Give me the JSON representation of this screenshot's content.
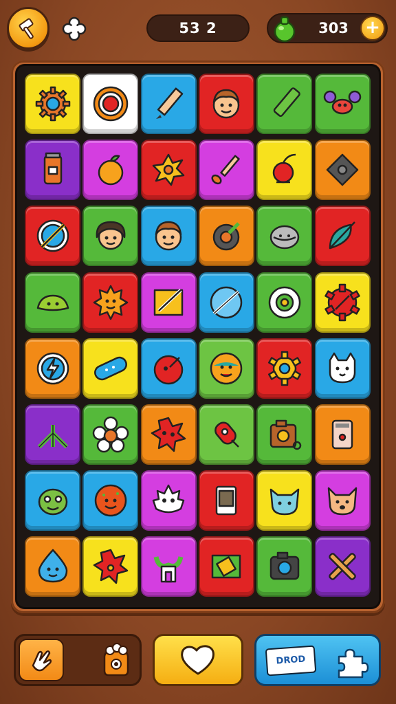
{
  "top_bar": {
    "moves_value": "53 2",
    "coins_value": "303",
    "plus_label": "+"
  },
  "board": {
    "rows": 8,
    "cols": 6,
    "tiles": [
      [
        {
          "color": "#f7e11d",
          "icon": "gear-icon"
        },
        {
          "color": "#ffffff",
          "icon": "target-icon"
        },
        {
          "color": "#29a8e6",
          "icon": "pencil-icon"
        },
        {
          "color": "#e12424",
          "icon": "boy-face-icon"
        },
        {
          "color": "#55b93a",
          "icon": "marker-icon"
        },
        {
          "color": "#55b93a",
          "icon": "crab-icon"
        }
      ],
      [
        {
          "color": "#8a2fc9",
          "icon": "jar-icon"
        },
        {
          "color": "#d43ee0",
          "icon": "orange-icon"
        },
        {
          "color": "#e12424",
          "icon": "splat-icon"
        },
        {
          "color": "#d43ee0",
          "icon": "brush-icon"
        },
        {
          "color": "#f7e11d",
          "icon": "cherry-icon"
        },
        {
          "color": "#f28a16",
          "icon": "diamond-icon"
        }
      ],
      [
        {
          "color": "#e12424",
          "icon": "compass-icon"
        },
        {
          "color": "#55b93a",
          "icon": "girl-face-icon"
        },
        {
          "color": "#29a8e6",
          "icon": "boy-face-icon"
        },
        {
          "color": "#f28a16",
          "icon": "donut-icon"
        },
        {
          "color": "#55b93a",
          "icon": "helmet-icon"
        },
        {
          "color": "#e12424",
          "icon": "leaf-icon"
        }
      ],
      [
        {
          "color": "#55b93a",
          "icon": "blob-icon"
        },
        {
          "color": "#e12424",
          "icon": "sun-face-icon"
        },
        {
          "color": "#d43ee0",
          "icon": "note-icon"
        },
        {
          "color": "#29a8e6",
          "icon": "planet-icon"
        },
        {
          "color": "#55b93a",
          "icon": "cog-ring-icon"
        },
        {
          "color": "#f7e11d",
          "icon": "red-cog-icon"
        }
      ],
      [
        {
          "color": "#f28a16",
          "icon": "bolt-icon"
        },
        {
          "color": "#f7e11d",
          "icon": "bandage-icon"
        },
        {
          "color": "#29a8e6",
          "icon": "red-ball-icon"
        },
        {
          "color": "#6dc443",
          "icon": "smiley-icon"
        },
        {
          "color": "#e12424",
          "icon": "gear-yellow-icon"
        },
        {
          "color": "#29a8e6",
          "icon": "cat-icon"
        }
      ],
      [
        {
          "color": "#8a2fc9",
          "icon": "sprout-icon"
        },
        {
          "color": "#55b93a",
          "icon": "flower-icon"
        },
        {
          "color": "#f28a16",
          "icon": "red-splat-icon"
        },
        {
          "color": "#6dc443",
          "icon": "rocket-icon"
        },
        {
          "color": "#55b93a",
          "icon": "camera-icon"
        },
        {
          "color": "#f28a16",
          "icon": "phone-icon"
        }
      ],
      [
        {
          "color": "#29a8e6",
          "icon": "alien-icon"
        },
        {
          "color": "#29a8e6",
          "icon": "cookie-icon"
        },
        {
          "color": "#d43ee0",
          "icon": "ghost-icon"
        },
        {
          "color": "#e12424",
          "icon": "device-icon"
        },
        {
          "color": "#f7e11d",
          "icon": "kitty-icon"
        },
        {
          "color": "#d43ee0",
          "icon": "fox-icon"
        }
      ],
      [
        {
          "color": "#f28a16",
          "icon": "drop-face-icon"
        },
        {
          "color": "#f7e11d",
          "icon": "star-splat-icon"
        },
        {
          "color": "#d43ee0",
          "icon": "plant-pot-icon"
        },
        {
          "color": "#e12424",
          "icon": "eraser-icon"
        },
        {
          "color": "#55b93a",
          "icon": "camera-dark-icon"
        },
        {
          "color": "#8a2fc9",
          "icon": "cross-tools-icon"
        }
      ]
    ]
  },
  "bottom_bar": {
    "card_label": "DROD"
  }
}
